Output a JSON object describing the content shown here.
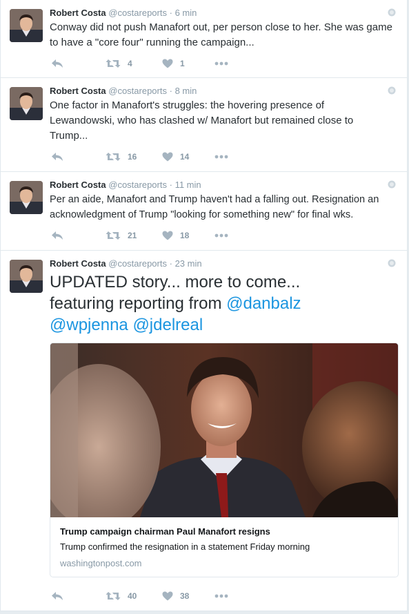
{
  "tweets": [
    {
      "name": "Robert Costa",
      "handle": "@costareports",
      "separator": "·",
      "time": "6 min",
      "text": "Conway did not push Manafort out, per person close to her. She was game to have a \"core four\" running the campaign...",
      "retweets": "4",
      "likes": "1"
    },
    {
      "name": "Robert Costa",
      "handle": "@costareports",
      "separator": "·",
      "time": "8 min",
      "text": "One factor in Manafort's struggles: the hovering presence of Lewandowski, who has clashed w/ Manafort but remained close to Trump...",
      "retweets": "16",
      "likes": "14"
    },
    {
      "name": "Robert Costa",
      "handle": "@costareports",
      "separator": "·",
      "time": "11 min",
      "text": "Per an aide, Manafort and Trump haven't had a falling out. Resignation an acknowledgment of Trump \"looking for something new\" for final wks.",
      "retweets": "21",
      "likes": "18"
    },
    {
      "name": "Robert Costa",
      "handle": "@costareports",
      "separator": "·",
      "time": "23 min",
      "text_line1": "UPDATED story... more to come...",
      "text_line2_prefix": "featuring reporting from ",
      "mentions": [
        "@danbalz",
        "@wpjenna",
        "@jdelreal"
      ],
      "retweets": "40",
      "likes": "38",
      "card": {
        "title": "Trump campaign chairman Paul Manafort resigns",
        "description": "Trump confirmed the resignation in a statement Friday morning",
        "domain": "washingtonpost.com"
      }
    }
  ],
  "icons": {
    "reply": "reply-icon",
    "retweet": "retweet-icon",
    "like": "heart-icon",
    "more": "more-dots-icon",
    "globe": "globe-icon"
  },
  "colors": {
    "link": "#1b95e0",
    "muted": "#8899a6",
    "text": "#292f33"
  }
}
